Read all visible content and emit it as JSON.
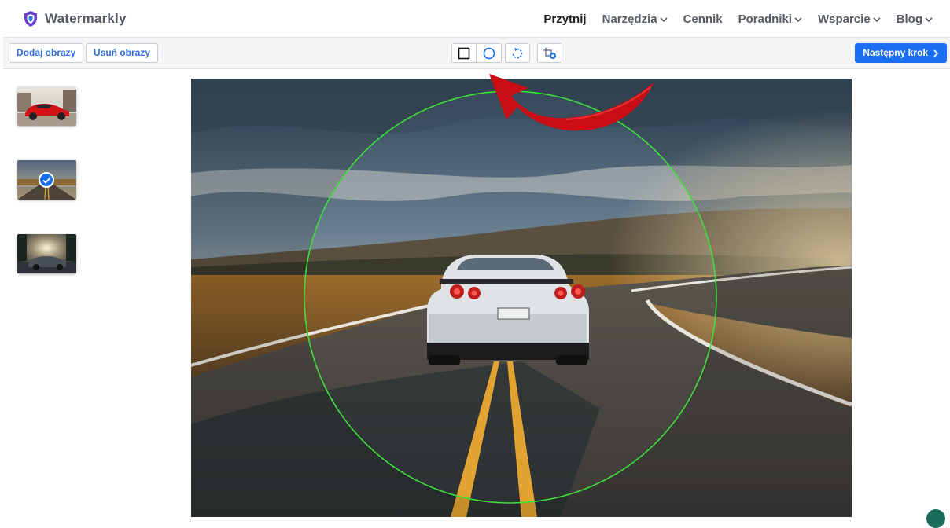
{
  "brand": {
    "name": "Watermarkly"
  },
  "nav": {
    "items": [
      {
        "label": "Przytnij",
        "active": true,
        "dropdown": false
      },
      {
        "label": "Narzędzia",
        "active": false,
        "dropdown": true
      },
      {
        "label": "Cennik",
        "active": false,
        "dropdown": false
      },
      {
        "label": "Poradniki",
        "active": false,
        "dropdown": true
      },
      {
        "label": "Wsparcie",
        "active": false,
        "dropdown": true
      },
      {
        "label": "Blog",
        "active": false,
        "dropdown": true
      }
    ]
  },
  "toolbar": {
    "add_label": "Dodaj obrazy",
    "remove_label": "Usuń obrazy",
    "tools": [
      "rectangle-shape-icon",
      "circle-shape-icon",
      "rotate-icon",
      "crop-add-icon"
    ],
    "next_label": "Następny krok"
  },
  "thumbnails": [
    {
      "name": "red-sports-car",
      "selected": false
    },
    {
      "name": "white-car-on-road",
      "selected": true
    },
    {
      "name": "dark-car-at-sunset",
      "selected": false
    }
  ],
  "colors": {
    "accent": "#1a6ff0",
    "crop_circle": "#3ee03a",
    "arrow": "#c80e14",
    "logo": "#6b3fd4"
  }
}
